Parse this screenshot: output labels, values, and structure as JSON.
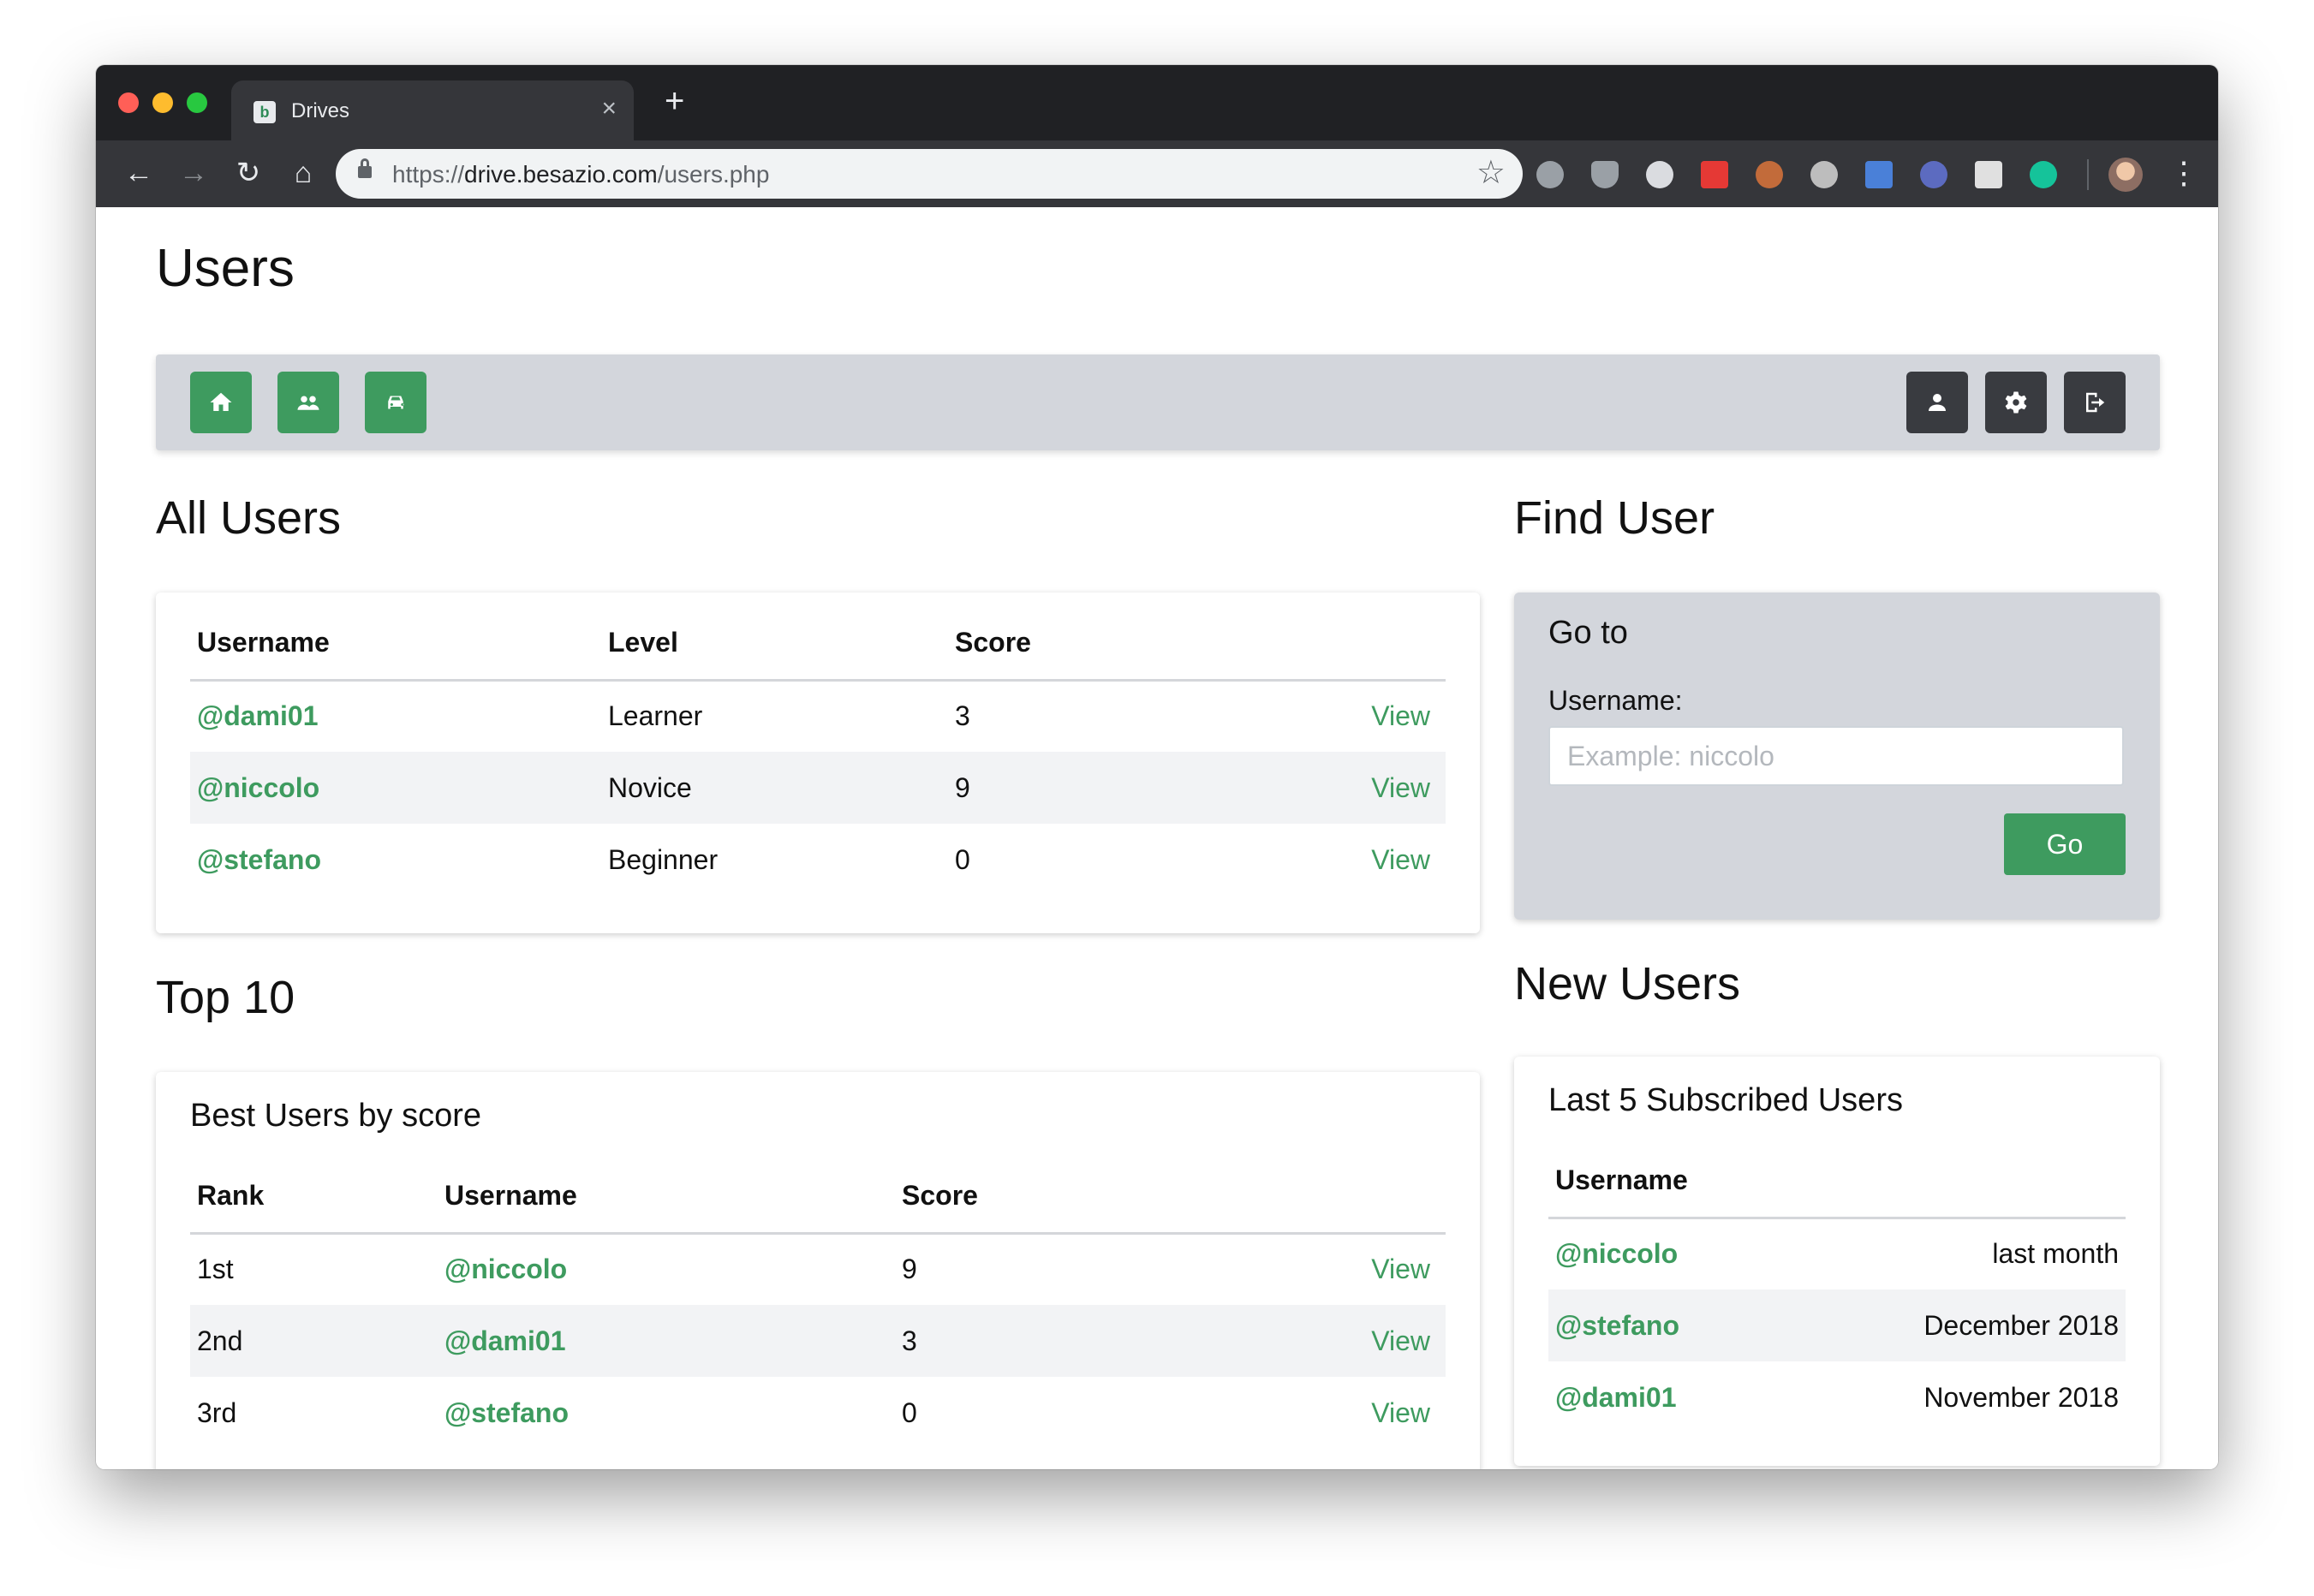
{
  "browser": {
    "tab_title": "Drives",
    "tab_favicon": "b",
    "url_scheme": "https://",
    "url_host": "drive.besazio.com",
    "url_path": "/users.php",
    "extensions": [
      "adblock-icon",
      "shield-icon",
      "block-icon",
      "quote-icon",
      "eyes-icon",
      "balls-icon",
      "translate-icon",
      "brain-icon",
      "face-icon",
      "grammarly-icon"
    ]
  },
  "page": {
    "title": "Users"
  },
  "navbar": {
    "left_icons": [
      "home-icon",
      "users-icon",
      "car-icon"
    ],
    "right_icons": [
      "profile-icon",
      "settings-icon",
      "logout-icon"
    ]
  },
  "all_users": {
    "title": "All Users",
    "columns": [
      "Username",
      "Level",
      "Score"
    ],
    "rows": [
      {
        "username": "@dami01",
        "level": "Learner",
        "score": "3",
        "action": "View"
      },
      {
        "username": "@niccolo",
        "level": "Novice",
        "score": "9",
        "action": "View"
      },
      {
        "username": "@stefano",
        "level": "Beginner",
        "score": "0",
        "action": "View"
      }
    ]
  },
  "find_user": {
    "title": "Find User",
    "card_title": "Go to",
    "label": "Username:",
    "placeholder": "Example: niccolo",
    "button": "Go"
  },
  "top10": {
    "title": "Top 10",
    "card_title": "Best Users by score",
    "columns": [
      "Rank",
      "Username",
      "Score"
    ],
    "rows": [
      {
        "rank": "1st",
        "username": "@niccolo",
        "score": "9",
        "action": "View"
      },
      {
        "rank": "2nd",
        "username": "@dami01",
        "score": "3",
        "action": "View"
      },
      {
        "rank": "3rd",
        "username": "@stefano",
        "score": "0",
        "action": "View"
      }
    ]
  },
  "new_users": {
    "title": "New Users",
    "card_title": "Last 5 Subscribed Users",
    "columns": [
      "Username"
    ],
    "rows": [
      {
        "username": "@niccolo",
        "when": "last month"
      },
      {
        "username": "@stefano",
        "when": "December 2018"
      },
      {
        "username": "@dami01",
        "when": "November 2018"
      }
    ]
  },
  "colors": {
    "accent": "#3e9b5f",
    "navbar_bg": "#d3d6dc",
    "dark_button": "#393b40"
  }
}
